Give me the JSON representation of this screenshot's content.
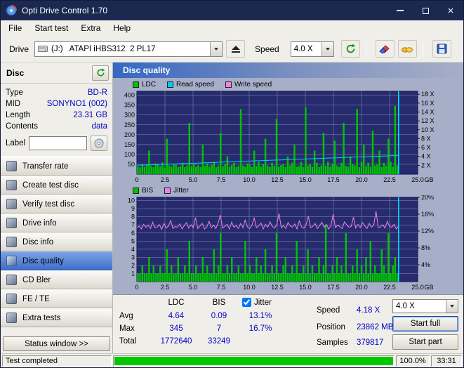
{
  "window": {
    "title": "Opti Drive Control 1.70"
  },
  "menu": {
    "items": [
      "File",
      "Start test",
      "Extra",
      "Help"
    ]
  },
  "toolbar": {
    "drive_label": "Drive",
    "drive_value": "(J:)   ATAPI iHBS312  2 PL17",
    "speed_label": "Speed",
    "speed_value": "4.0 X"
  },
  "sidebar": {
    "panel_title": "Disc",
    "info": [
      {
        "label": "Type",
        "value": "BD-R"
      },
      {
        "label": "MID",
        "value": "SONYNO1 (002)"
      },
      {
        "label": "Length",
        "value": "23.31 GB"
      },
      {
        "label": "Contents",
        "value": "data"
      }
    ],
    "label_caption": "Label",
    "label_value": "",
    "nav": [
      {
        "label": "Transfer rate",
        "active": false
      },
      {
        "label": "Create test disc",
        "active": false
      },
      {
        "label": "Verify test disc",
        "active": false
      },
      {
        "label": "Drive info",
        "active": false
      },
      {
        "label": "Disc info",
        "active": false
      },
      {
        "label": "Disc quality",
        "active": true
      },
      {
        "label": "CD Bler",
        "active": false
      },
      {
        "label": "FE / TE",
        "active": false
      },
      {
        "label": "Extra tests",
        "active": false
      }
    ],
    "status_window": "Status window >>"
  },
  "main": {
    "header": "Disc quality",
    "stats": {
      "row_labels": [
        "Avg",
        "Max",
        "Total"
      ],
      "columns": [
        {
          "header": "LDC",
          "avg": "4.64",
          "max": "345",
          "total": "1772640"
        },
        {
          "header": "BIS",
          "avg": "0.09",
          "max": "7",
          "total": "33249"
        }
      ],
      "jitter": {
        "label": "Jitter",
        "checked": true,
        "avg": "13.1%",
        "max": "16.7%"
      },
      "speed_label": "Speed",
      "speed_value": "4.18 X",
      "speed_select": "4.0 X",
      "position_label": "Position",
      "position_value": "23862 MB",
      "samples_label": "Samples",
      "samples_value": "379817",
      "start_full": "Start full",
      "start_part": "Start part"
    }
  },
  "statusbar": {
    "status": "Test completed",
    "percent": "100.0%",
    "time": "33:31",
    "progress": 100
  },
  "colors": {
    "titlebar": "#1b2951",
    "active_nav": "#3f6fc9",
    "value_blue": "#0000cc",
    "progress_green": "#00c800"
  },
  "chart_data": [
    {
      "type": "bar",
      "title": "Disc quality - LDC with read/write speed",
      "legend": [
        {
          "label": "LDC",
          "color": "#00c300"
        },
        {
          "label": "Read speed",
          "color": "#00ccff"
        },
        {
          "label": "Write speed",
          "color": "#f080e8"
        }
      ],
      "x_axis": {
        "ticks": [
          0,
          2.5,
          5,
          7.5,
          10,
          12.5,
          15,
          17.5,
          20,
          22.5,
          25
        ],
        "unit": "GB",
        "max": 25
      },
      "left_axis": {
        "ticks": [
          50,
          100,
          150,
          200,
          250,
          300,
          350,
          400
        ],
        "max": 420
      },
      "right_axis": {
        "unit": "X",
        "ticks": [
          2,
          4,
          6,
          8,
          10,
          12,
          14,
          16,
          18
        ],
        "scale": 22.5
      },
      "data_end_gb": 23.3,
      "plot_bg": "#262b6e",
      "grid_color": "#8d91b4",
      "end_marker_color": "#00e4ff",
      "bars": {
        "name": "LDC",
        "color": "#00c300",
        "values": [
          40,
          35,
          52,
          38,
          45,
          120,
          42,
          36,
          55,
          48,
          39,
          60,
          33,
          180,
          44,
          38,
          52,
          47,
          36,
          41,
          58,
          36,
          44,
          260,
          40,
          52,
          38,
          45,
          36,
          150,
          42,
          55,
          38,
          48,
          63,
          36,
          44,
          210,
          40,
          52,
          90,
          38,
          46,
          58,
          36,
          42,
          330,
          44,
          38,
          55,
          48,
          36,
          120,
          42,
          63,
          38,
          52,
          180,
          44,
          36,
          58,
          42,
          280,
          38,
          46,
          52,
          36,
          90,
          44,
          58,
          150,
          38,
          42,
          63,
          36,
          340,
          44,
          52,
          38,
          120,
          58,
          36,
          44,
          210,
          42,
          63,
          38,
          52,
          170,
          44,
          36,
          58,
          260,
          42,
          38,
          90,
          52,
          44,
          330,
          36,
          63,
          150,
          42,
          58,
          38,
          220,
          44,
          52,
          120,
          36,
          58,
          42,
          180,
          63,
          38,
          345,
          44
        ]
      },
      "lines": [
        {
          "name": "Read speed",
          "color": "#00ccff",
          "unit": "X",
          "scale": 22.5,
          "values": [
            2.02,
            2.05,
            2.1,
            2.16,
            2.2,
            2.26,
            2.3,
            2.36,
            2.42,
            2.46,
            2.52,
            2.58,
            2.62,
            2.68,
            2.74,
            2.78,
            2.84,
            2.9,
            2.95,
            3.0,
            3.05,
            3.1,
            3.16,
            3.2,
            3.26,
            3.32,
            3.36,
            3.42,
            3.48,
            3.52,
            3.58,
            3.64,
            3.68,
            3.74,
            3.8,
            3.85,
            3.9,
            3.96,
            4.0,
            4.06,
            4.1,
            4.15,
            4.18
          ]
        }
      ]
    },
    {
      "type": "bar",
      "title": "Disc quality - BIS with jitter",
      "legend": [
        {
          "label": "BIS",
          "color": "#00c300"
        },
        {
          "label": "Jitter",
          "color": "#f080e8"
        }
      ],
      "x_axis": {
        "ticks": [
          0,
          2.5,
          5,
          7.5,
          10,
          12.5,
          15,
          17.5,
          20,
          22.5,
          25
        ],
        "unit": "GB",
        "max": 25
      },
      "left_axis": {
        "ticks": [
          1,
          2,
          3,
          4,
          5,
          6,
          7,
          8,
          9,
          10
        ],
        "max": 10.4
      },
      "right_axis": {
        "unit": "%",
        "ticks": [
          4,
          8,
          12,
          16,
          20
        ],
        "scale": 0.52
      },
      "data_end_gb": 23.3,
      "plot_bg": "#262b6e",
      "grid_color": "#8d91b4",
      "end_marker_color": "#00e4ff",
      "bars": {
        "name": "BIS",
        "color": "#00c300",
        "values": [
          1,
          1,
          2,
          1,
          1,
          3,
          1,
          2,
          1,
          1,
          2,
          1,
          1,
          4,
          1,
          2,
          1,
          1,
          3,
          1,
          1,
          2,
          1,
          5,
          1,
          1,
          2,
          1,
          1,
          3,
          1,
          2,
          1,
          1,
          4,
          1,
          2,
          6,
          1,
          1,
          2,
          1,
          3,
          1,
          1,
          2,
          1,
          1,
          5,
          1,
          2,
          1,
          1,
          3,
          1,
          2,
          1,
          4,
          1,
          1,
          2,
          1,
          6,
          1,
          1,
          2,
          3,
          1,
          1,
          2,
          1,
          5,
          1,
          1,
          2,
          1,
          4,
          1,
          2,
          1,
          1,
          3,
          1,
          2,
          7,
          1,
          1,
          2,
          1,
          3,
          1,
          2,
          1,
          6,
          1,
          1,
          2,
          1,
          4,
          1,
          2,
          1,
          3,
          1,
          5,
          1,
          2,
          1,
          1,
          4,
          2,
          1,
          6,
          1,
          2,
          3,
          1
        ]
      },
      "lines": [
        {
          "name": "Jitter",
          "color": "#f080e8",
          "unit": "%",
          "scale": 0.52,
          "values": [
            12.8,
            13.2,
            12.5,
            13.6,
            12.9,
            13.4,
            12.6,
            14.1,
            12.8,
            13.0,
            13.5,
            12.4,
            13.8,
            12.7,
            13.2,
            14.5,
            12.6,
            13.1,
            12.9,
            13.7,
            12.5,
            13.3,
            14.0,
            12.7,
            13.5,
            12.8,
            15.2,
            12.6,
            13.2,
            13.8,
            12.5,
            13.0,
            14.3,
            12.8,
            13.4,
            12.6,
            13.9,
            15.8,
            12.7,
            13.1,
            13.6,
            12.5,
            14.1,
            12.9,
            13.3,
            12.6,
            13.8,
            12.8,
            14.6,
            13.0,
            12.6,
            13.4,
            15.1,
            12.8,
            13.2,
            13.9,
            12.5,
            13.6,
            12.9,
            14.2,
            13.1,
            12.7,
            13.5,
            16.2,
            12.8,
            13.3,
            12.6,
            14.0,
            13.2,
            12.9,
            13.7,
            12.5,
            14.4,
            13.0,
            12.7,
            13.5,
            15.5,
            12.8,
            13.1,
            13.8,
            12.6,
            13.3,
            14.1,
            12.9,
            13.6,
            12.5,
            13.2,
            16.0,
            12.8,
            13.4,
            13.0,
            12.6,
            14.2,
            13.5,
            12.9,
            13.1,
            15.3,
            12.7,
            13.6,
            12.8,
            14.0,
            13.2,
            12.6,
            13.8,
            12.9,
            13.4,
            16.7,
            12.8,
            13.0,
            13.5,
            12.7,
            14.3,
            13.1,
            12.9,
            13.6,
            12.5,
            13.2
          ]
        }
      ]
    }
  ]
}
